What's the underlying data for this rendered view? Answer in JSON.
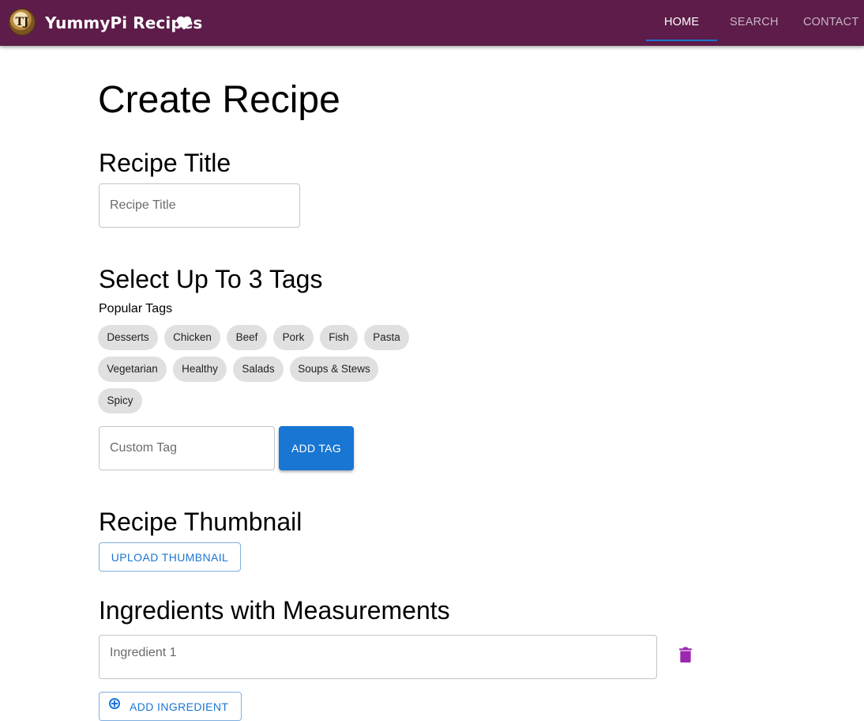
{
  "header": {
    "brand": "YummyPi Recipes",
    "logo_text": "TJ",
    "nav": [
      {
        "label": "HOME",
        "active": true
      },
      {
        "label": "SEARCH",
        "active": false
      },
      {
        "label": "CONTACT",
        "active": false
      }
    ],
    "accent": "#1976d2",
    "bar_color": "#5d1c49"
  },
  "page": {
    "title": "Create Recipe",
    "recipe_title": {
      "heading": "Recipe Title",
      "placeholder": "Recipe Title",
      "value": ""
    },
    "tags": {
      "heading": "Select Up To 3 Tags",
      "popular_label": "Popular Tags",
      "popular": [
        "Desserts",
        "Chicken",
        "Beef",
        "Pork",
        "Fish",
        "Pasta",
        "Vegetarian",
        "Healthy",
        "Salads",
        "Soups & Stews",
        "Spicy"
      ],
      "custom_placeholder": "Custom Tag",
      "add_button": "ADD TAG"
    },
    "thumbnail": {
      "heading": "Recipe Thumbnail",
      "upload_button": "UPLOAD THUMBNAIL"
    },
    "ingredients": {
      "heading": "Ingredients with Measurements",
      "items": [
        {
          "placeholder": "Ingredient 1",
          "value": ""
        }
      ],
      "add_button": "ADD INGREDIENT",
      "delete_icon_color": "#9c27b0"
    }
  }
}
